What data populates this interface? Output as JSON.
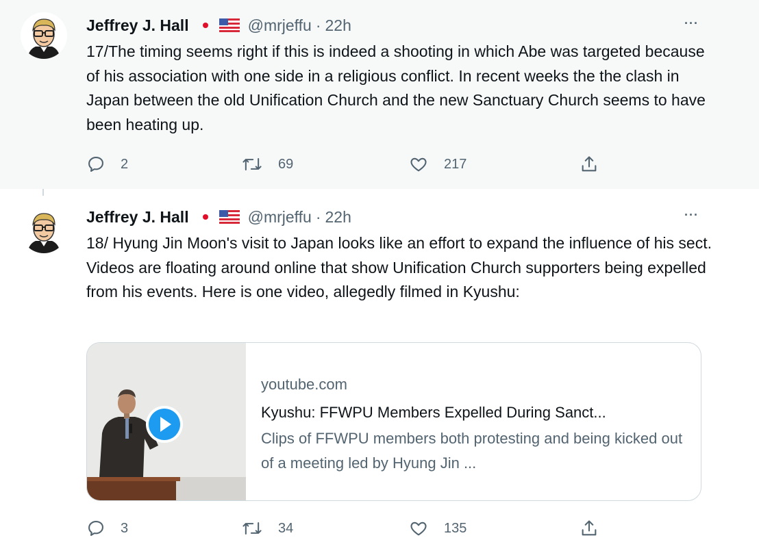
{
  "tweets": [
    {
      "author_name": "Jeffrey J. Hall",
      "handle": "@mrjeffu",
      "separator": "·",
      "time": "22h",
      "more": "···",
      "text": "17/The timing seems right if this is indeed a shooting in which Abe was targeted because of his association with one side in a religious conflict. In recent weeks the the clash in Japan between the old Unification Church and the new Sanctuary Church seems to have been heating up.",
      "replies": "2",
      "retweets": "69",
      "likes": "217"
    },
    {
      "author_name": "Jeffrey J. Hall",
      "handle": "@mrjeffu",
      "separator": "·",
      "time": "22h",
      "more": "···",
      "text": "18/ Hyung Jin Moon's visit to Japan looks like an effort to expand the influence of his sect.  Videos are floating around online that show Unification Church supporters being expelled from his events.  Here is one video, allegedly filmed in Kyushu:",
      "card": {
        "domain": "youtube.com",
        "title": "Kyushu: FFWPU Members Expelled During Sanct...",
        "description": "Clips of FFWPU members both protesting and being kicked out of a meeting led by Hyung Jin ..."
      },
      "replies": "3",
      "retweets": "34",
      "likes": "135"
    }
  ],
  "icons": {
    "reply": "reply-icon",
    "retweet": "retweet-icon",
    "like": "heart-icon",
    "share": "share-icon",
    "play": "play-icon"
  },
  "colors": {
    "text": "#0f1419",
    "secondary": "#536471",
    "play_button": "#1d9bf0",
    "jp_flag_red": "#e0102a",
    "thread_line": "#cfd9de"
  }
}
